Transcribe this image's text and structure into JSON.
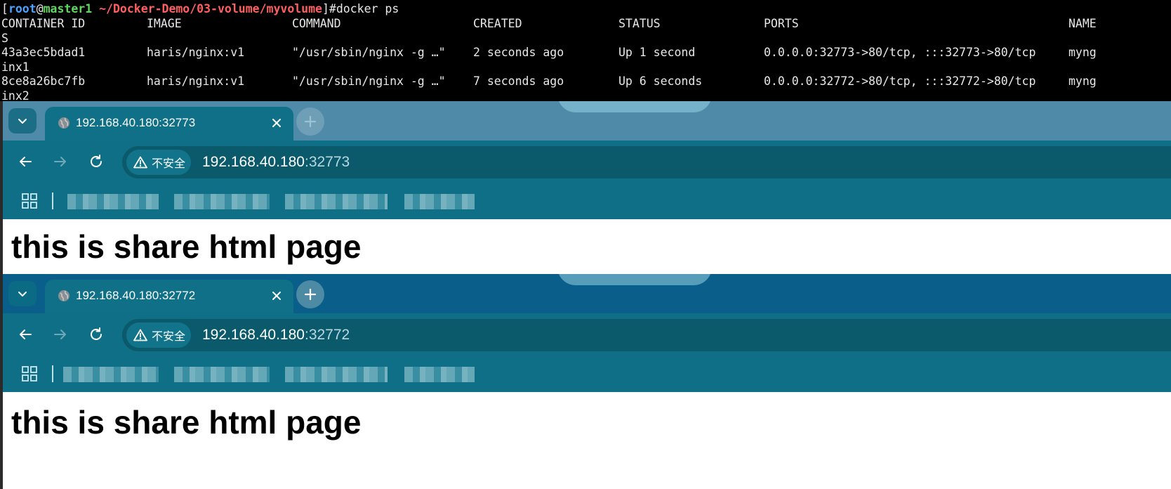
{
  "terminal": {
    "prompt": {
      "open_bracket": "[",
      "user": "root",
      "at": "@",
      "host": "master1",
      "path": " ~/Docker-Demo/03-volume/myvolume",
      "close_bracket": "]#",
      "command": "docker ps"
    },
    "headers": {
      "container_id": "CONTAINER ID",
      "image": "IMAGE",
      "command": "COMMAND",
      "created": "CREATED",
      "status": "STATUS",
      "ports": "PORTS",
      "names": "NAME",
      "names_wrap": "S"
    },
    "rows": [
      {
        "container_id": "43a3ec5bdad1",
        "image": "haris/nginx:v1",
        "command": "\"/usr/sbin/nginx -g …\"",
        "created": "2 seconds ago",
        "status": "Up 1 second",
        "ports": "0.0.0.0:32773->80/tcp, :::32773->80/tcp",
        "name": "myng",
        "name_wrap": "inx1"
      },
      {
        "container_id": "8ce8a26bc7fb",
        "image": "haris/nginx:v1",
        "command": "\"/usr/sbin/nginx -g …\"",
        "created": "7 seconds ago",
        "status": "Up 6 seconds",
        "ports": "0.0.0.0:32772->80/tcp, :::32772->80/tcp",
        "name": "myng",
        "name_wrap": "inx2"
      }
    ]
  },
  "browsers": [
    {
      "tab_title": "192.168.40.180:32773",
      "security_label": "不安全",
      "url_host": "192.168.40.180",
      "url_port": ":32773",
      "page_heading": "this is share html page",
      "colors": {
        "tabstrip": "#4f8ba8",
        "tab": "#0f7088",
        "toolbar": "#0e6f86",
        "omnibox": "#0a5a6c",
        "bookmarks": "#0e6f86"
      }
    },
    {
      "tab_title": "192.168.40.180:32772",
      "security_label": "不安全",
      "url_host": "192.168.40.180",
      "url_port": ":32772",
      "page_heading": "this is share html page",
      "colors": {
        "tabstrip": "#0a5e8a",
        "tab": "#0f7088",
        "toolbar": "#0e6f86",
        "omnibox": "#0a5a6c",
        "bookmarks": "#0e6f86"
      }
    }
  ]
}
